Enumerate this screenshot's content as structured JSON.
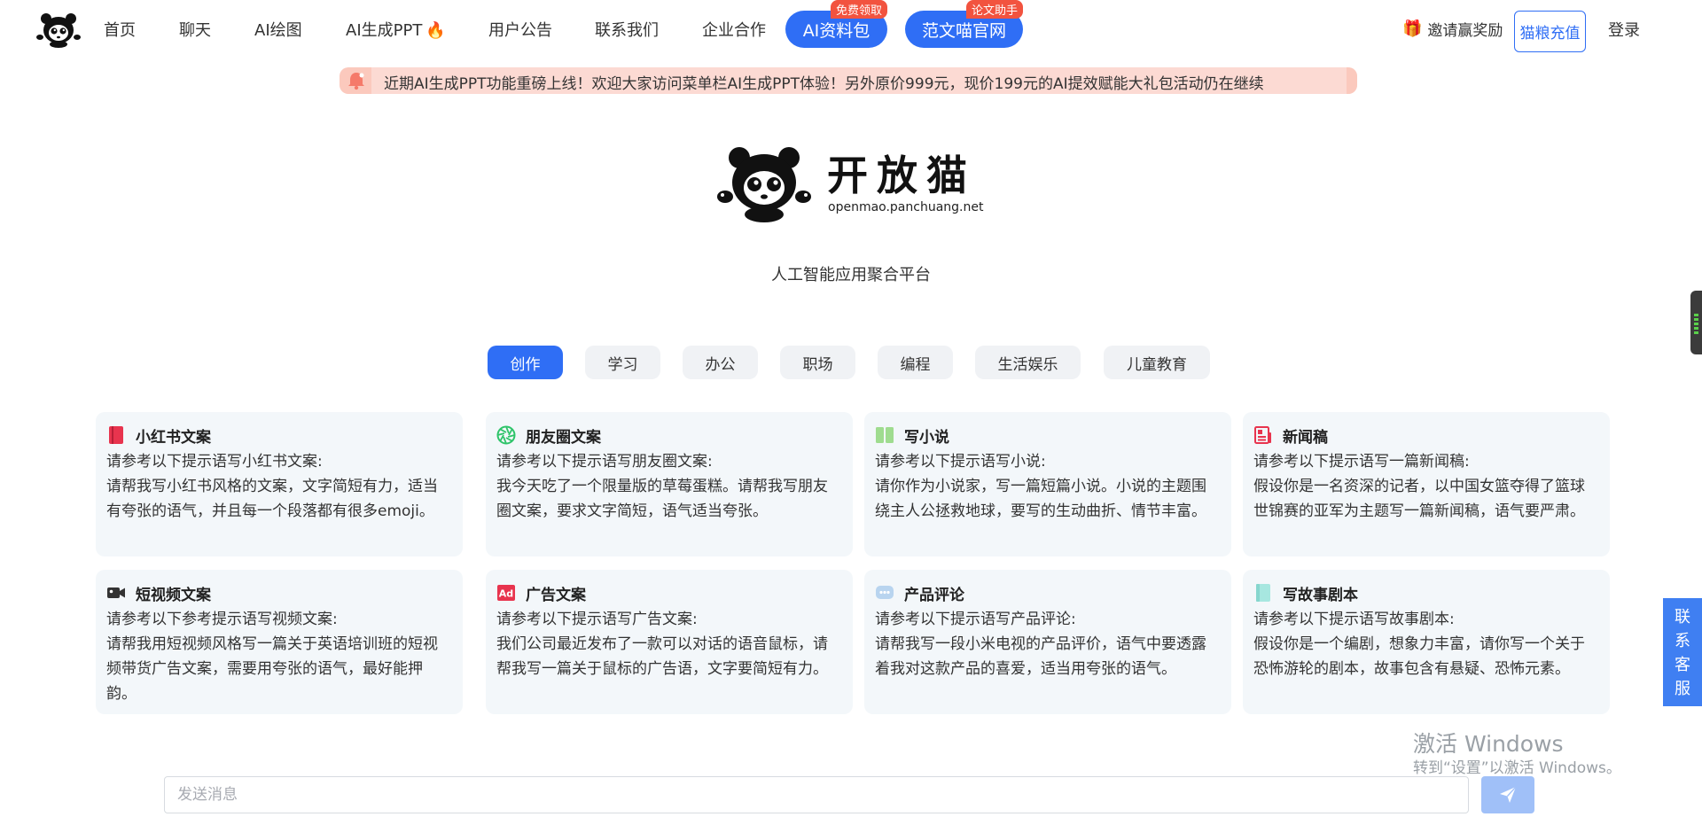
{
  "nav": {
    "items": [
      "首页",
      "聊天",
      "AI绘图",
      "AI生成PPT",
      "用户公告",
      "联系我们",
      "企业合作"
    ],
    "pill1": {
      "label": "AI资料包",
      "badge": "免费领取"
    },
    "pill2": {
      "label": "范文喵官网",
      "badge": "论文助手"
    },
    "invite": "邀请赢奖励",
    "recharge": "猫粮充值",
    "login": "登录"
  },
  "notice": "近期AI生成PPT功能重磅上线！欢迎大家访问菜单栏AI生成PPT体验！另外原价999元，现价199元的AI提效赋能大礼包活动仍在继续",
  "brand": {
    "name": "开放猫",
    "domain": "openmao.panchuang.net",
    "subtitle": "人工智能应用聚合平台"
  },
  "tabs": [
    "创作",
    "学习",
    "办公",
    "职场",
    "编程",
    "生活娱乐",
    "儿童教育"
  ],
  "active_tab": "创作",
  "cards": [
    {
      "title": "小红书文案",
      "line1": "请参考以下提示语写小红书文案:",
      "body": "请帮我写小红书风格的文案，文字简短有力，适当有夸张的语气，并且每一个段落都有很多emoji。",
      "icon": "book-icon",
      "color": "#e8344e"
    },
    {
      "title": "朋友圈文案",
      "line1": "请参考以下提示语写朋友圈文案:",
      "body": "我今天吃了一个限量版的草莓蛋糕。请帮我写朋友圈文案，要求文字简短，语气适当夸张。",
      "icon": "aperture-icon",
      "color": "#2fc46a"
    },
    {
      "title": "写小说",
      "line1": "请参考以下提示语写小说:",
      "body": "请你作为小说家，写一篇短篇小说。小说的主题围绕主人公拯救地球，要写的生动曲折、情节丰富。",
      "icon": "open-book-icon",
      "color": "#9fdc8f"
    },
    {
      "title": "新闻稿",
      "line1": "请参考以下提示语写一篇新闻稿:",
      "body": "假设你是一名资深的记者，以中国女篮夺得了篮球世锦赛的亚军为主题写一篇新闻稿，语气要严肃。",
      "icon": "newspaper-icon",
      "color": "#e8344e"
    },
    {
      "title": "短视频文案",
      "line1": "请参考以下参考提示语写视频文案:",
      "body": "请帮我用短视频风格写一篇关于英语培训班的短视频带货广告文案，需要用夸张的语气，最好能押韵。",
      "icon": "video-camera-icon",
      "color": "#333333"
    },
    {
      "title": "广告文案",
      "line1": "请参考以下提示语写广告文案:",
      "body": "我们公司最近发布了一款可以对话的语音鼠标，请帮我写一篇关于鼠标的广告语，文字要简短有力。",
      "icon": "ad-icon",
      "color": "#e8344e"
    },
    {
      "title": "产品评论",
      "line1": "请参考以下提示语写产品评论:",
      "body": "请帮我写一段小米电视的产品评价，语气中要透露着我对这款产品的喜爱，适当用夸张的语气。",
      "icon": "chat-bubble-icon",
      "color": "#b8d4ef"
    },
    {
      "title": "写故事剧本",
      "line1": "请参考以下提示语写故事剧本:",
      "body": "假设你是一个编剧，想象力丰富，请你写一个关于恐怖游轮的剧本，故事包含有悬疑、恐怖元素。",
      "icon": "script-icon",
      "color": "#a7e7e0"
    }
  ],
  "contact": "联系客服",
  "watermark": {
    "line1": "激活 Windows",
    "line2": "转到“设置”以激活 Windows。"
  },
  "input": {
    "placeholder": "发送消息"
  },
  "colors": {
    "primary": "#2f6ef5",
    "badge": "#f2533f",
    "notice_bg": "#fcdad3",
    "card_bg": "#f3f7fa"
  }
}
